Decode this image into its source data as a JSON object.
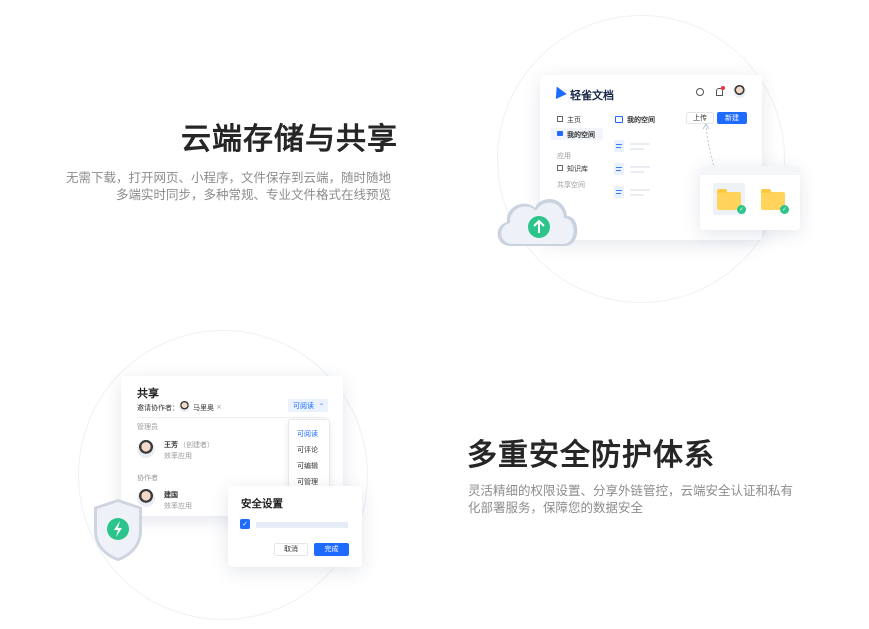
{
  "section_storage": {
    "title": "云端存储与共享",
    "desc_line1": "无需下载，打开网页、小程序，文件保存到云端，随时随地",
    "desc_line2": "多端实时同步，多种常规、专业文件格式在线预览",
    "app": {
      "name": "轻雀文档",
      "nav_home": "主页",
      "nav_myspace": "我的空间",
      "nav_section_apps": "应用",
      "nav_knowledge": "知识库",
      "nav_shared": "共享空间",
      "main_title": "我的空间",
      "upload_label": "上传",
      "new_label": "新建"
    }
  },
  "section_security": {
    "title": "多重安全防护体系",
    "desc_line1": "灵活精细的权限设置、分享外链管控，云端安全认证和私有",
    "desc_line2": "化部署服务，保障您的数据安全",
    "share": {
      "title": "共享",
      "invite_label": "邀请协作者：",
      "invitee_name": "马里奥",
      "invitee_remove": "×",
      "permission_value": "可阅读",
      "admin_section": "管理员",
      "admin_name": "王芳",
      "admin_role": "（创建者）",
      "admin_org": "效率应用",
      "collab_section": "协作者",
      "collab_name": "建国",
      "collab_org": "效率应用",
      "options": [
        "可阅读",
        "可评论",
        "可编辑",
        "可管理"
      ]
    },
    "security_dialog": {
      "title": "安全设置",
      "cancel_label": "取消",
      "confirm_label": "完成"
    }
  },
  "colors": {
    "accent": "#1f6bff",
    "success": "#2bc48a",
    "folder": "#ffd35c"
  }
}
